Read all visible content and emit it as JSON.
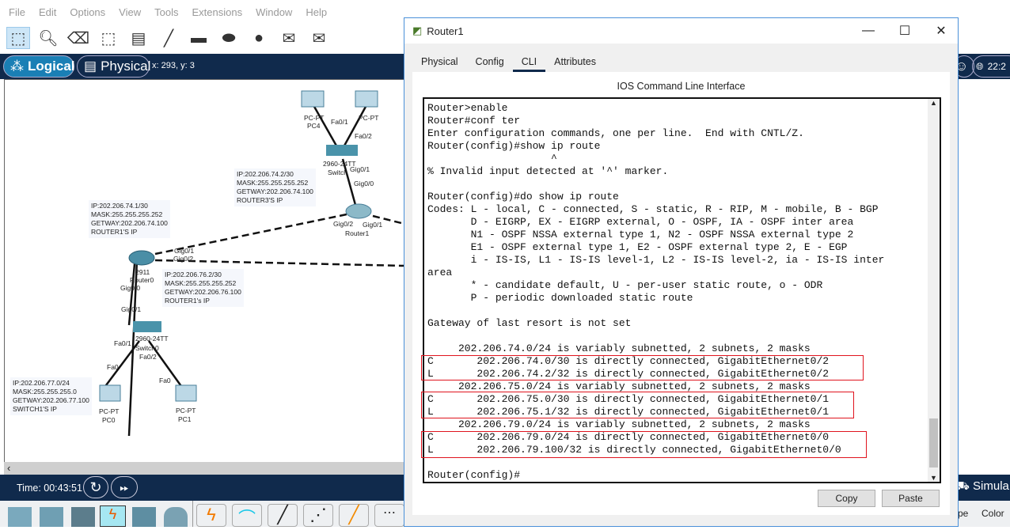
{
  "menu": [
    "File",
    "Edit",
    "Options",
    "View",
    "Tools",
    "Extensions",
    "Window",
    "Help"
  ],
  "nav": {
    "logical": "Logical",
    "physical": "Physical",
    "coords": "x: 293, y: 3",
    "clock": "22:2"
  },
  "time": {
    "label": "Time: 00:43:51",
    "simulation": "Simula"
  },
  "bottom_cols": [
    "pe",
    "Color"
  ],
  "diagram": {
    "notes": [
      "IP:202.206.74.2/30\nMASK:255.255.255.252\nGETWAY:202.206.74.100\nROUTER3'S IP",
      "IP:202.206.74.1/30\nMASK:255.255.255.252\nGETWAY:202.206.74.100\nROUTER1'S IP",
      "IP:202.206.76.2/30\nMASK:255.255.255.252\nGETWAY:202.206.76.100\nROUTER1's IP",
      "IP:202.206.77.0/24\nMASK:255.255.255.0\nGETWAY:202.206.77.100\nSWITCH1'S IP"
    ],
    "labels": {
      "pc4": "PC4",
      "pcpt_a": "PC-PT",
      "pcpt_b": "PC-PT",
      "fa01_top": "Fa0/1",
      "fa02_top": "Fa0/2",
      "switch_top": "2960-24TT",
      "switch_top_name": "Switch",
      "gig01_sw": "Gig0/1",
      "gig00_r1": "Gig0/0",
      "gig02_r1": "Gig0/2",
      "gig01_r1": "Gig0/1",
      "router1": "Router1",
      "r0_model": "2911",
      "router0": "Router0",
      "gig01_r0": "Gig0/1",
      "gig02_r0": "Gig0/2",
      "gig00_r0": "Gig0/0",
      "gig01_sw2": "Gig0/1",
      "switch2": "2960-24TT",
      "switch2_name": "Switch0",
      "fa01": "Fa0/1",
      "fa02": "Fa0/2",
      "fa0_a": "Fa0",
      "fa0_b": "Fa0",
      "pc0_type": "PC-PT",
      "pc0": "PC0",
      "pc1_type": "PC-PT",
      "pc1": "PC1"
    }
  },
  "window": {
    "title": "Router1",
    "tabs": [
      "Physical",
      "Config",
      "CLI",
      "Attributes"
    ],
    "active_tab": "CLI",
    "cli_title": "IOS Command Line Interface",
    "cli_lines": [
      "Router>enable",
      "Router#conf ter",
      "Enter configuration commands, one per line.  End with CNTL/Z.",
      "Router(config)#show ip route",
      "                    ^",
      "% Invalid input detected at '^' marker.",
      "",
      "Router(config)#do show ip route",
      "Codes: L - local, C - connected, S - static, R - RIP, M - mobile, B - BGP",
      "       D - EIGRP, EX - EIGRP external, O - OSPF, IA - OSPF inter area",
      "       N1 - OSPF NSSA external type 1, N2 - OSPF NSSA external type 2",
      "       E1 - OSPF external type 1, E2 - OSPF external type 2, E - EGP",
      "       i - IS-IS, L1 - IS-IS level-1, L2 - IS-IS level-2, ia - IS-IS inter",
      "area",
      "       * - candidate default, U - per-user static route, o - ODR",
      "       P - periodic downloaded static route",
      "",
      "Gateway of last resort is not set",
      "",
      "     202.206.74.0/24 is variably subnetted, 2 subnets, 2 masks",
      "C       202.206.74.0/30 is directly connected, GigabitEthernet0/2",
      "L       202.206.74.2/32 is directly connected, GigabitEthernet0/2",
      "     202.206.75.0/24 is variably subnetted, 2 subnets, 2 masks",
      "C       202.206.75.0/30 is directly connected, GigabitEthernet0/1",
      "L       202.206.75.1/32 is directly connected, GigabitEthernet0/1",
      "     202.206.79.0/24 is variably subnetted, 2 subnets, 2 masks",
      "C       202.206.79.0/24 is directly connected, GigabitEthernet0/0",
      "L       202.206.79.100/32 is directly connected, GigabitEthernet0/0",
      "",
      "Router(config)#"
    ],
    "copy": "Copy",
    "paste": "Paste",
    "highlight_color": "#e0141e"
  }
}
